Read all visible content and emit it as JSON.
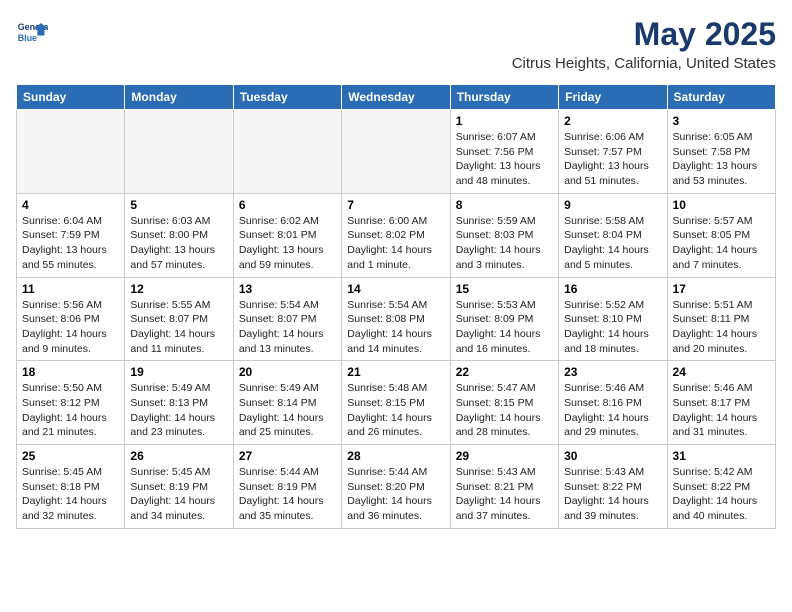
{
  "header": {
    "logo_line1": "General",
    "logo_line2": "Blue",
    "month": "May 2025",
    "location": "Citrus Heights, California, United States"
  },
  "days_of_week": [
    "Sunday",
    "Monday",
    "Tuesday",
    "Wednesday",
    "Thursday",
    "Friday",
    "Saturday"
  ],
  "weeks": [
    [
      {
        "day": "",
        "info": ""
      },
      {
        "day": "",
        "info": ""
      },
      {
        "day": "",
        "info": ""
      },
      {
        "day": "",
        "info": ""
      },
      {
        "day": "1",
        "info": "Sunrise: 6:07 AM\nSunset: 7:56 PM\nDaylight: 13 hours and 48 minutes."
      },
      {
        "day": "2",
        "info": "Sunrise: 6:06 AM\nSunset: 7:57 PM\nDaylight: 13 hours and 51 minutes."
      },
      {
        "day": "3",
        "info": "Sunrise: 6:05 AM\nSunset: 7:58 PM\nDaylight: 13 hours and 53 minutes."
      }
    ],
    [
      {
        "day": "4",
        "info": "Sunrise: 6:04 AM\nSunset: 7:59 PM\nDaylight: 13 hours and 55 minutes."
      },
      {
        "day": "5",
        "info": "Sunrise: 6:03 AM\nSunset: 8:00 PM\nDaylight: 13 hours and 57 minutes."
      },
      {
        "day": "6",
        "info": "Sunrise: 6:02 AM\nSunset: 8:01 PM\nDaylight: 13 hours and 59 minutes."
      },
      {
        "day": "7",
        "info": "Sunrise: 6:00 AM\nSunset: 8:02 PM\nDaylight: 14 hours and 1 minute."
      },
      {
        "day": "8",
        "info": "Sunrise: 5:59 AM\nSunset: 8:03 PM\nDaylight: 14 hours and 3 minutes."
      },
      {
        "day": "9",
        "info": "Sunrise: 5:58 AM\nSunset: 8:04 PM\nDaylight: 14 hours and 5 minutes."
      },
      {
        "day": "10",
        "info": "Sunrise: 5:57 AM\nSunset: 8:05 PM\nDaylight: 14 hours and 7 minutes."
      }
    ],
    [
      {
        "day": "11",
        "info": "Sunrise: 5:56 AM\nSunset: 8:06 PM\nDaylight: 14 hours and 9 minutes."
      },
      {
        "day": "12",
        "info": "Sunrise: 5:55 AM\nSunset: 8:07 PM\nDaylight: 14 hours and 11 minutes."
      },
      {
        "day": "13",
        "info": "Sunrise: 5:54 AM\nSunset: 8:07 PM\nDaylight: 14 hours and 13 minutes."
      },
      {
        "day": "14",
        "info": "Sunrise: 5:54 AM\nSunset: 8:08 PM\nDaylight: 14 hours and 14 minutes."
      },
      {
        "day": "15",
        "info": "Sunrise: 5:53 AM\nSunset: 8:09 PM\nDaylight: 14 hours and 16 minutes."
      },
      {
        "day": "16",
        "info": "Sunrise: 5:52 AM\nSunset: 8:10 PM\nDaylight: 14 hours and 18 minutes."
      },
      {
        "day": "17",
        "info": "Sunrise: 5:51 AM\nSunset: 8:11 PM\nDaylight: 14 hours and 20 minutes."
      }
    ],
    [
      {
        "day": "18",
        "info": "Sunrise: 5:50 AM\nSunset: 8:12 PM\nDaylight: 14 hours and 21 minutes."
      },
      {
        "day": "19",
        "info": "Sunrise: 5:49 AM\nSunset: 8:13 PM\nDaylight: 14 hours and 23 minutes."
      },
      {
        "day": "20",
        "info": "Sunrise: 5:49 AM\nSunset: 8:14 PM\nDaylight: 14 hours and 25 minutes."
      },
      {
        "day": "21",
        "info": "Sunrise: 5:48 AM\nSunset: 8:15 PM\nDaylight: 14 hours and 26 minutes."
      },
      {
        "day": "22",
        "info": "Sunrise: 5:47 AM\nSunset: 8:15 PM\nDaylight: 14 hours and 28 minutes."
      },
      {
        "day": "23",
        "info": "Sunrise: 5:46 AM\nSunset: 8:16 PM\nDaylight: 14 hours and 29 minutes."
      },
      {
        "day": "24",
        "info": "Sunrise: 5:46 AM\nSunset: 8:17 PM\nDaylight: 14 hours and 31 minutes."
      }
    ],
    [
      {
        "day": "25",
        "info": "Sunrise: 5:45 AM\nSunset: 8:18 PM\nDaylight: 14 hours and 32 minutes."
      },
      {
        "day": "26",
        "info": "Sunrise: 5:45 AM\nSunset: 8:19 PM\nDaylight: 14 hours and 34 minutes."
      },
      {
        "day": "27",
        "info": "Sunrise: 5:44 AM\nSunset: 8:19 PM\nDaylight: 14 hours and 35 minutes."
      },
      {
        "day": "28",
        "info": "Sunrise: 5:44 AM\nSunset: 8:20 PM\nDaylight: 14 hours and 36 minutes."
      },
      {
        "day": "29",
        "info": "Sunrise: 5:43 AM\nSunset: 8:21 PM\nDaylight: 14 hours and 37 minutes."
      },
      {
        "day": "30",
        "info": "Sunrise: 5:43 AM\nSunset: 8:22 PM\nDaylight: 14 hours and 39 minutes."
      },
      {
        "day": "31",
        "info": "Sunrise: 5:42 AM\nSunset: 8:22 PM\nDaylight: 14 hours and 40 minutes."
      }
    ]
  ]
}
